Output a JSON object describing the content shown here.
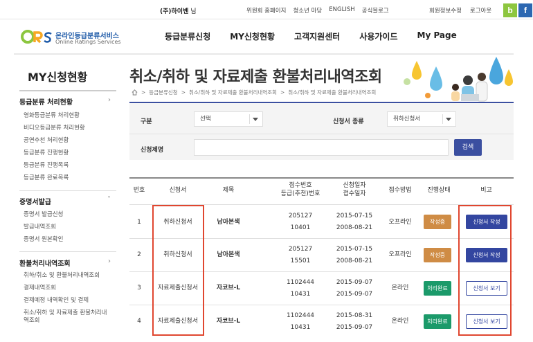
{
  "topbar": {
    "user_name": "(주)하이벤",
    "user_suffix": "님",
    "links": [
      "위원회 홈페이지",
      "청소년 마당",
      "ENGLISH",
      "공식블로그"
    ],
    "account_links": [
      "회원정보수정",
      "로그아웃"
    ],
    "blog_letter": "b",
    "facebook_letter": "f",
    "colors": {
      "blog": "#8dc63f",
      "facebook": "#2c67b1"
    }
  },
  "logo": {
    "mark": "ORs",
    "korean": "온라인등급분류서비스",
    "english": "Online Ratings Services"
  },
  "gnb": [
    "등급분류신청",
    "MY신청현황",
    "고객지원센터",
    "사용가이드",
    "My Page"
  ],
  "sidebar": {
    "title": "MY신청현황",
    "sections": [
      {
        "label": "등급분류 처리현황",
        "arrow": "›",
        "items": [
          "영화등급분류 처리현황",
          "비디오등급분류 처리현황",
          "공연추천 처리현황",
          "등급분류 진행현황",
          "등급분류 진행목록",
          "등급분류 완료목록"
        ]
      },
      {
        "label": "증명서발급",
        "arrow": "˅",
        "items": [
          "증명서 발급신청",
          "발급내역조회",
          "증명서 원본확인"
        ]
      },
      {
        "label": "환불처리내역조회",
        "arrow": "›",
        "items": [
          "취하/취소 및 환불처리내역조회",
          "결제내역조회",
          "결제예정 내역확인 및 결제",
          "취소/취하 및 자료제출 환불처리내역조회"
        ]
      }
    ]
  },
  "page": {
    "title": "취소/취하 및 자료제출 환불처리내역조회",
    "breadcrumb": [
      "등급분류신청",
      "취소/취하 및 자료제출 환불처리내역조회",
      "취소/취하 및 자료제출 환불처리내역조회"
    ],
    "accent": "#3b4fa0"
  },
  "search": {
    "category_label": "구분",
    "category_value": "선택",
    "type_label": "신청서 종류",
    "type_value": "취하신청서",
    "name_label": "신청제명",
    "name_value": "",
    "search_button": "검색"
  },
  "table": {
    "headers": [
      "번호",
      "신청서",
      "제목",
      "접수번호\n등급(추천)번호",
      "신청일자\n접수일자",
      "접수방법",
      "진행상태",
      "비고"
    ],
    "rows": [
      {
        "no": "1",
        "form": "취하신청서",
        "title": "남아본색",
        "receipt": "205127",
        "rating_no": "10401",
        "apply_date": "2015-07-15",
        "receive_date": "2008-08-21",
        "method": "오프라인",
        "status": "작성중",
        "status_color": "#cf8c45",
        "action": "신청서 작성",
        "action_style": "filled"
      },
      {
        "no": "2",
        "form": "취하신청서",
        "title": "남아본색",
        "receipt": "205127",
        "rating_no": "15501",
        "apply_date": "2015-07-15",
        "receive_date": "2008-08-21",
        "method": "오프라인",
        "status": "작성중",
        "status_color": "#cf8c45",
        "action": "신청서 작성",
        "action_style": "filled"
      },
      {
        "no": "3",
        "form": "자료제출신청서",
        "title": "자코브-L",
        "receipt": "1102444",
        "rating_no": "10431",
        "apply_date": "2015-09-07",
        "receive_date": "2015-09-07",
        "method": "온라인",
        "status": "처리완료",
        "status_color": "#1b9a6a",
        "action": "신청서 보기",
        "action_style": "outline"
      },
      {
        "no": "4",
        "form": "자료제출신청서",
        "title": "자코브-L",
        "receipt": "1102444",
        "rating_no": "10431",
        "apply_date": "2015-08-31",
        "receive_date": "2015-09-07",
        "method": "온라인",
        "status": "처리완료",
        "status_color": "#1b9a6a",
        "action": "신청서 보기",
        "action_style": "outline"
      }
    ]
  },
  "highlight_color": "#e0462f"
}
